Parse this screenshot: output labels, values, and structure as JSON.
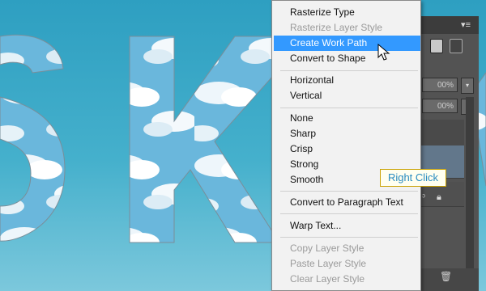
{
  "context_menu": {
    "items": [
      {
        "label": "Rasterize Type",
        "state": "enabled"
      },
      {
        "label": "Rasterize Layer Style",
        "state": "disabled"
      },
      {
        "label": "Create Work Path",
        "state": "highlighted"
      },
      {
        "label": "Convert to Shape",
        "state": "enabled"
      },
      {
        "label": "Horizontal",
        "state": "enabled"
      },
      {
        "label": "Vertical",
        "state": "enabled"
      },
      {
        "label": "None",
        "state": "enabled"
      },
      {
        "label": "Sharp",
        "state": "enabled"
      },
      {
        "label": "Crisp",
        "state": "enabled"
      },
      {
        "label": "Strong",
        "state": "enabled"
      },
      {
        "label": "Smooth",
        "state": "enabled"
      },
      {
        "label": "Convert to Paragraph Text",
        "state": "enabled"
      },
      {
        "label": "Warp Text...",
        "state": "enabled"
      },
      {
        "label": "Copy Layer Style",
        "state": "disabled"
      },
      {
        "label": "Paste Layer Style",
        "state": "disabled"
      },
      {
        "label": "Clear Layer Style",
        "state": "disabled"
      }
    ]
  },
  "tooltip": {
    "text": "Right Click"
  },
  "layers_panel": {
    "opacity": "00%",
    "fill": "00%"
  },
  "canvas_text": "SKY",
  "colors": {
    "sky": "#3aa8c8",
    "menu_bg": "#f2f2f2",
    "menu_highlight": "#3399ff",
    "panel_bg": "#535353",
    "tooltip_text": "#2a8cc0"
  },
  "icons": [
    "panel-menu-icon",
    "layer-button-icon",
    "mask-button-icon",
    "lock-icon",
    "link-icon",
    "trash-icon",
    "cursor-icon"
  ]
}
